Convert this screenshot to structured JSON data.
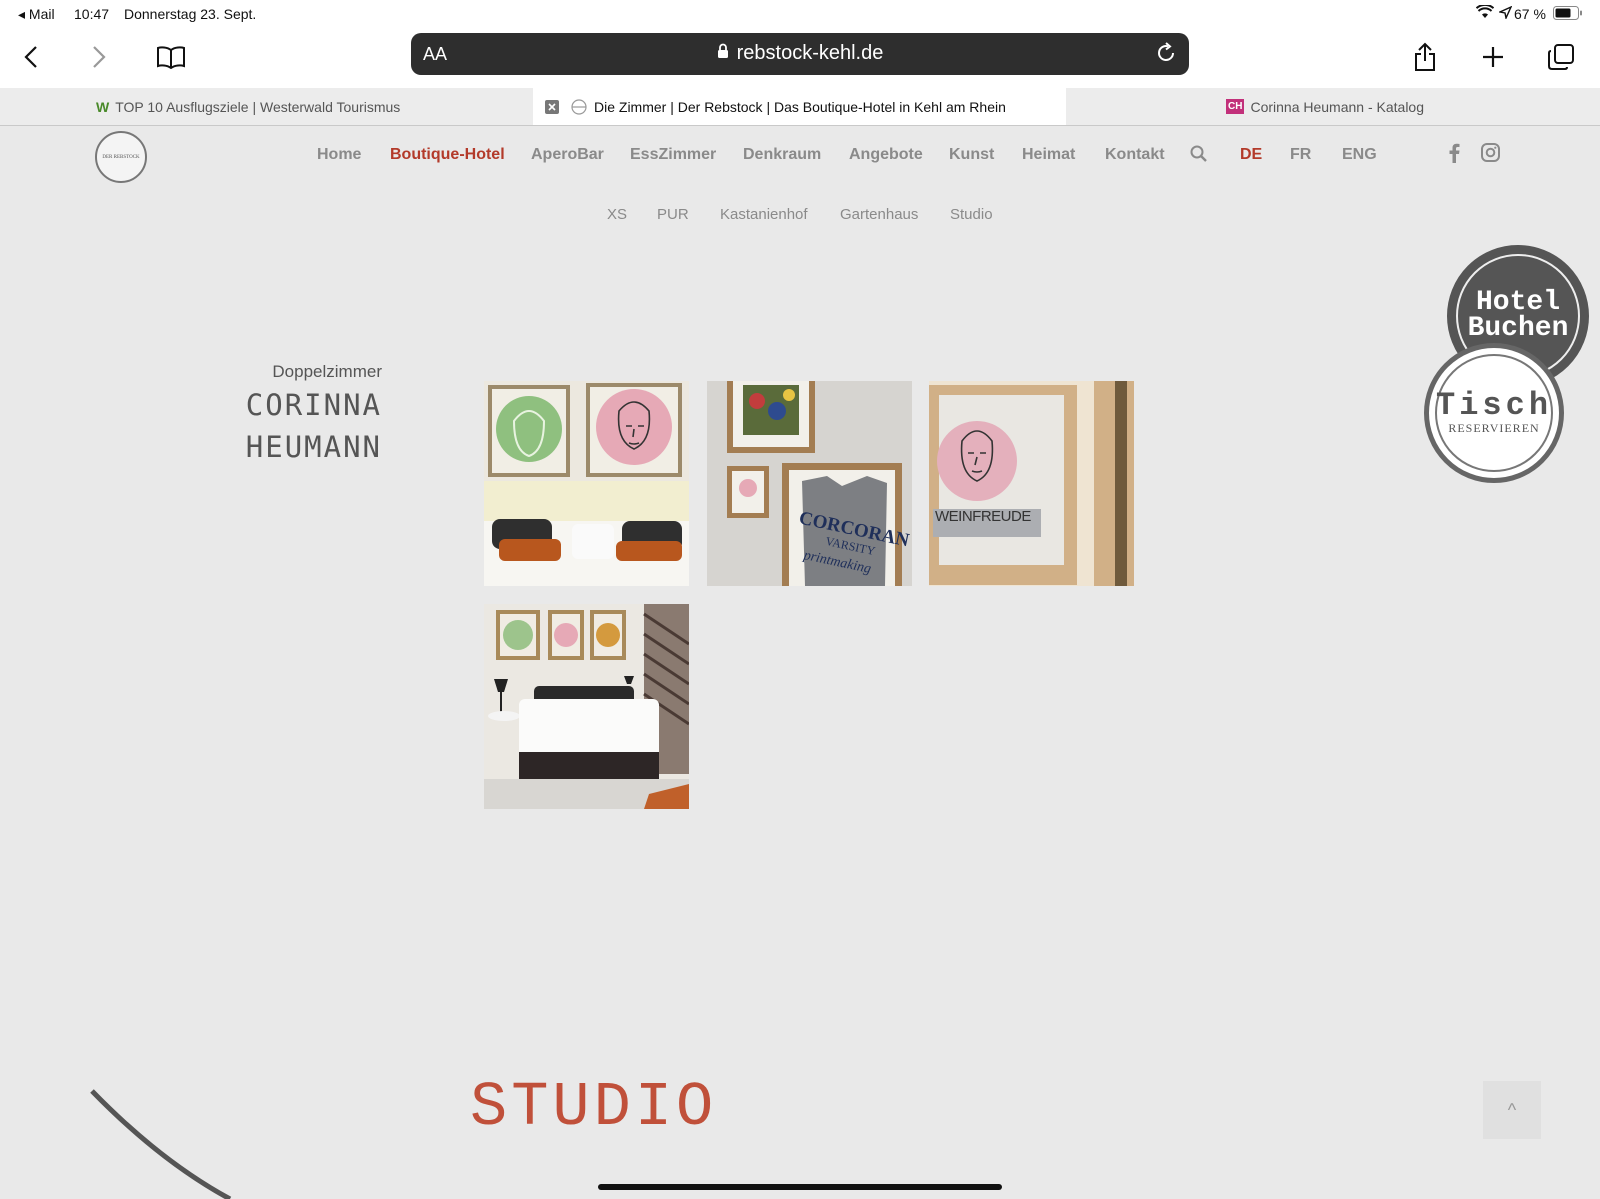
{
  "status_bar": {
    "back_app": "◂ Mail",
    "time": "10:47",
    "date": "Donnerstag 23. Sept.",
    "battery": "67 %"
  },
  "browser": {
    "aa_label": "AA",
    "url": "rebstock-kehl.de",
    "tabs": [
      {
        "favicon": "W",
        "title": "TOP 10 Ausflugsziele | Westerwald Tourismus"
      },
      {
        "title": "Die Zimmer | Der Rebstock | Das Boutique-Hotel in Kehl am Rhein"
      },
      {
        "favicon": "CH",
        "title": "Corinna Heumann - Katalog"
      }
    ]
  },
  "site": {
    "logo_text": "DER REBSTOCK",
    "nav": [
      "Home",
      "Boutique-Hotel",
      "AperoBar",
      "EssZimmer",
      "Denkraum",
      "Angebote",
      "Kunst",
      "Heimat",
      "Kontakt"
    ],
    "languages": [
      "DE",
      "FR",
      "ENG"
    ],
    "subnav": [
      "XS",
      "PUR",
      "Kastanienhof",
      "Gartenhaus",
      "Studio"
    ],
    "badge_hotel": {
      "line1": "Hotel",
      "line2": "Buchen"
    },
    "badge_tisch": {
      "line1": "Tisch",
      "line2": "RESERVIEREN"
    },
    "caption": {
      "small": "Doppelzimmer",
      "line1": "CORINNA",
      "line2": "HEUMANN"
    },
    "photos": {
      "tshirt_text1": "CORCORAN",
      "tshirt_text2": "VARSITY",
      "tshirt_text3": "printmaking",
      "weinfreude": "WEINFREUDE"
    },
    "section_title": "STUDIO",
    "to_top": "^"
  },
  "colors": {
    "accent": "#b33a2a",
    "nav_gray": "#8a8a8a",
    "background": "#e9e9e9"
  }
}
